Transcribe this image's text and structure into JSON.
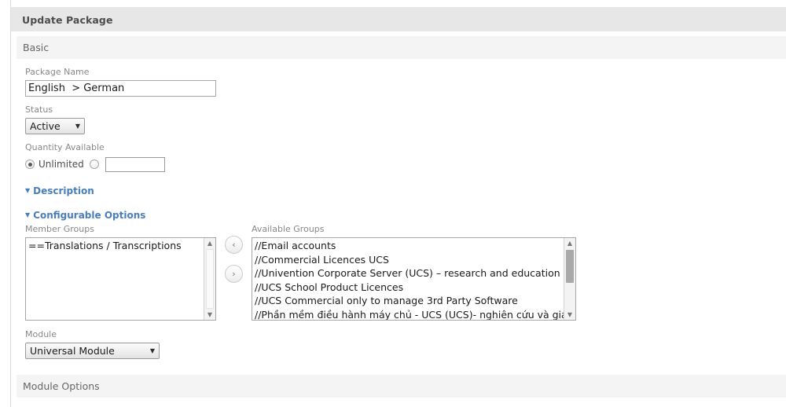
{
  "window": {
    "title": "Update Package"
  },
  "sections": {
    "basic": "Basic",
    "module_options": "Module Options"
  },
  "fields": {
    "package_name": {
      "label": "Package Name",
      "value": "English  > German",
      "placeholder": ""
    },
    "status": {
      "label": "Status",
      "value": "Active",
      "caret": "▼"
    },
    "quantity": {
      "label": "Quantity Available",
      "unlimited_label": "Unlimited",
      "unlimited_selected": true,
      "limited_selected": false,
      "amount_value": "",
      "amount_placeholder": ""
    },
    "module": {
      "label": "Module",
      "value": "Universal Module",
      "caret": "▼"
    }
  },
  "collapsibles": {
    "description": {
      "label": "Description",
      "triangle": "▼",
      "expanded": true
    },
    "configurable_options": {
      "label": "Configurable Options",
      "triangle": "▼",
      "expanded": true
    }
  },
  "dual_list": {
    "member_groups": {
      "label": "Member Groups",
      "items": [
        "==Translations / Transcriptions"
      ]
    },
    "available_groups": {
      "label": "Available Groups",
      "items": [
        "//Email accounts",
        "//Commercial Licences UCS",
        "//Univention Corporate Server (UCS) – research and education",
        "//UCS School Product Licences",
        "//UCS Commercial only to manage 3rd Party Software",
        "//Phần mềm điều hành máy chủ - UCS (UCS)- nghiên cứu và giáo duc"
      ]
    },
    "buttons": {
      "move_left": "‹",
      "move_right": "›"
    },
    "scroll": {
      "up_arrow": "▲",
      "down_arrow": "▼"
    }
  },
  "colors": {
    "titlebar_bg": "#e7e7e7",
    "sectionbar_bg": "#f4f4f4",
    "collapse_link": "#4a7ebb",
    "label_text": "#888888",
    "page_bg": "#ffffff"
  }
}
